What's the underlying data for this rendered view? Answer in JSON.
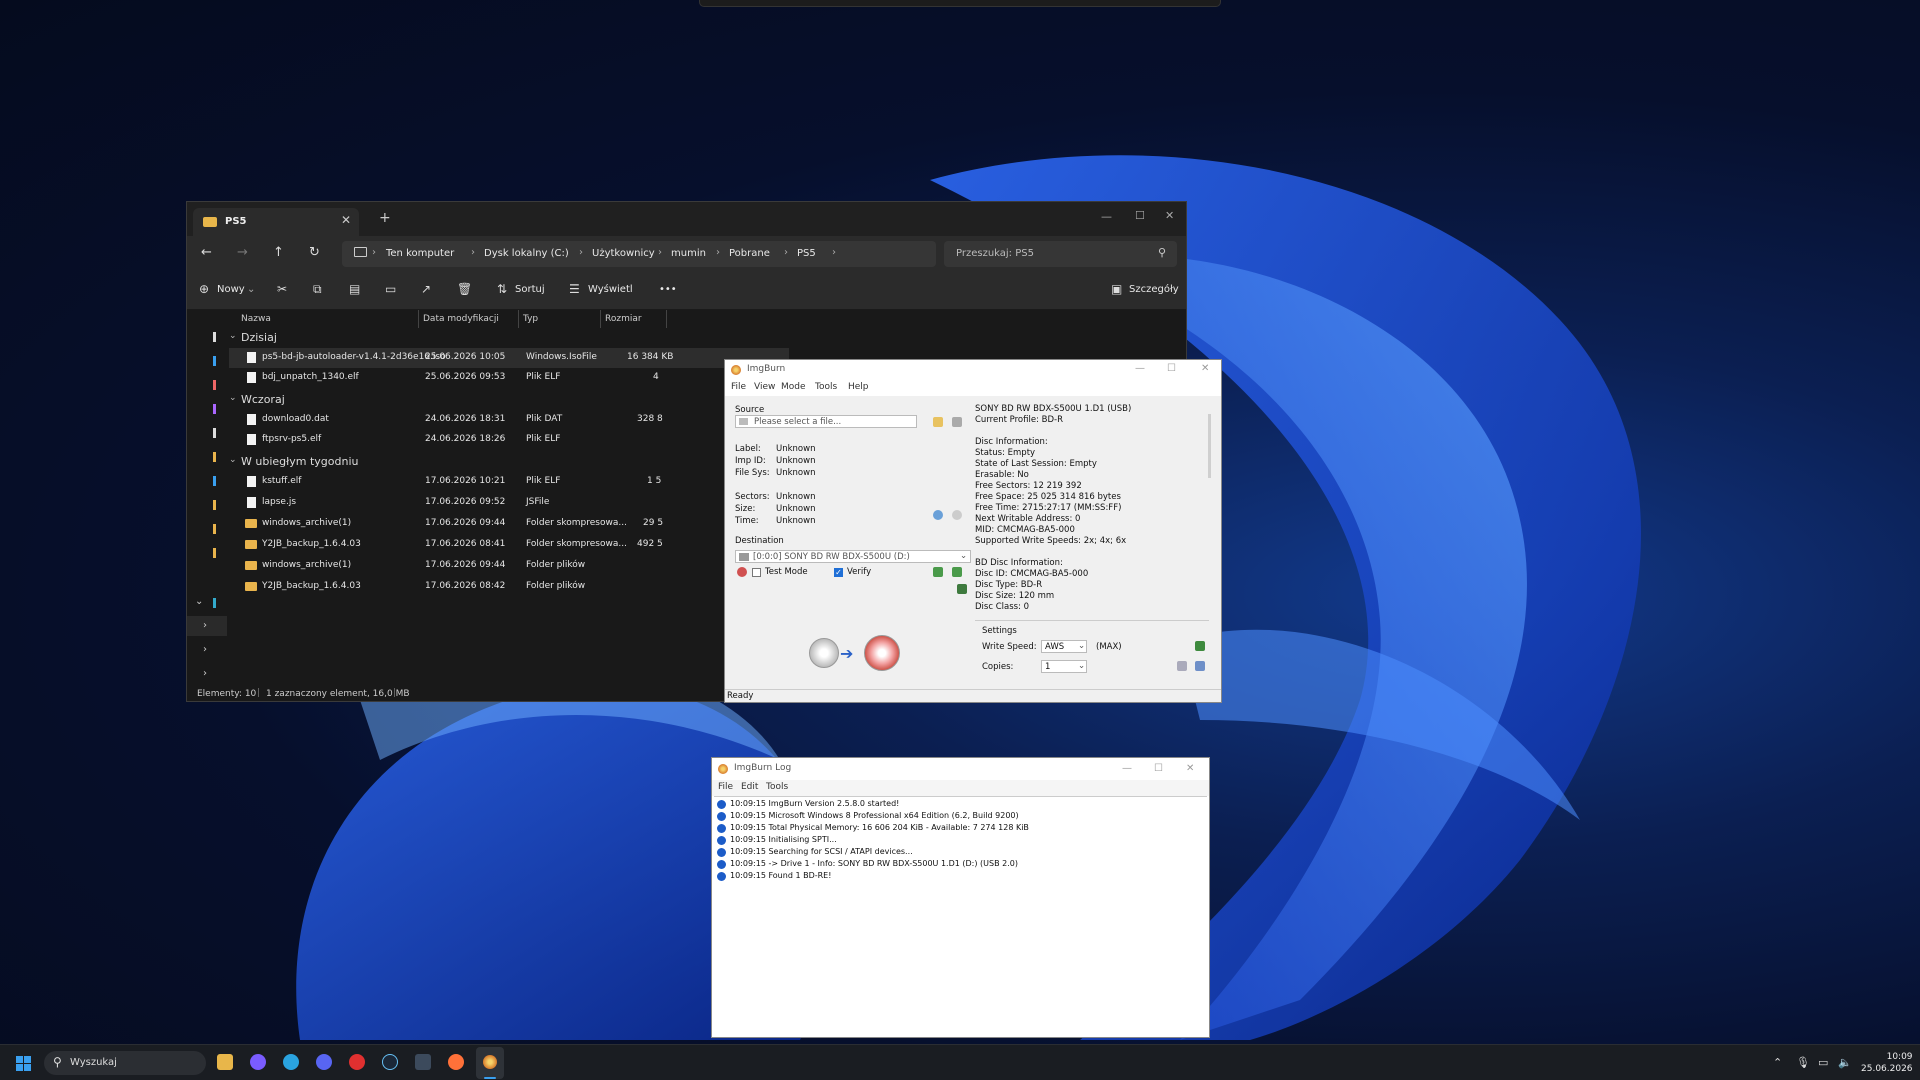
{
  "explorer": {
    "tab_title": "PS5",
    "close_tab": "✕",
    "new_tab": "+",
    "nav": {
      "back": "←",
      "forward": "→",
      "up": "↑",
      "refresh": "↻"
    },
    "breadcrumb": [
      "Ten komputer",
      "Dysk lokalny (C:)",
      "Użytkownicy",
      "mumin",
      "Pobrane",
      "PS5"
    ],
    "search_placeholder": "Przeszukaj: PS5",
    "toolbar": {
      "new": "Nowy",
      "sort": "Sortuj",
      "view": "Wyświetl",
      "more": "•••",
      "details": "Szczegóły"
    },
    "columns": {
      "name": "Nazwa",
      "date": "Data modyfikacji",
      "type": "Typ",
      "size": "Rozmiar"
    },
    "groups": [
      {
        "label": "Dzisiaj",
        "items": [
          {
            "name": "ps5-bd-jb-autoloader-v1.4.1-2d36e16.iso",
            "date": "25.06.2026 10:05",
            "type": "Windows.IsoFile",
            "size": "16 384 KB",
            "kind": "file",
            "selected": true
          },
          {
            "name": "bdj_unpatch_1340.elf",
            "date": "25.06.2026 09:53",
            "type": "Plik ELF",
            "size": "4",
            "kind": "file"
          }
        ]
      },
      {
        "label": "Wczoraj",
        "items": [
          {
            "name": "download0.dat",
            "date": "24.06.2026 18:31",
            "type": "Plik DAT",
            "size": "328 8",
            "kind": "file"
          },
          {
            "name": "ftpsrv-ps5.elf",
            "date": "24.06.2026 18:26",
            "type": "Plik ELF",
            "size": "",
            "kind": "file"
          }
        ]
      },
      {
        "label": "W ubiegłym tygodniu",
        "items": [
          {
            "name": "kstuff.elf",
            "date": "17.06.2026 10:21",
            "type": "Plik ELF",
            "size": "1 5",
            "kind": "file"
          },
          {
            "name": "lapse.js",
            "date": "17.06.2026 09:52",
            "type": "JSFile",
            "size": "",
            "kind": "file"
          },
          {
            "name": "windows_archive(1)",
            "date": "17.06.2026 09:44",
            "type": "Folder skompresowa...",
            "size": "29 5",
            "kind": "folder"
          },
          {
            "name": "Y2JB_backup_1.6.4.03",
            "date": "17.06.2026 08:41",
            "type": "Folder skompresowa...",
            "size": "492 5",
            "kind": "folder"
          },
          {
            "name": "windows_archive(1)",
            "date": "17.06.2026 09:44",
            "type": "Folder plików",
            "size": "",
            "kind": "folder"
          },
          {
            "name": "Y2JB_backup_1.6.4.03",
            "date": "17.06.2026 08:42",
            "type": "Folder plików",
            "size": "",
            "kind": "folder"
          }
        ]
      }
    ],
    "status_left": "Elementy: 10",
    "status_right": "1 zaznaczony element, 16,0 MB"
  },
  "imgburn": {
    "title": "ImgBurn",
    "menu": [
      "File",
      "View",
      "Mode",
      "Tools",
      "Help"
    ],
    "source_label": "Source",
    "source_placeholder": "Please select a file...",
    "fields": [
      {
        "k": "Label:",
        "v": "Unknown"
      },
      {
        "k": "Imp ID:",
        "v": "Unknown"
      },
      {
        "k": "File Sys:",
        "v": "Unknown"
      }
    ],
    "fields2": [
      {
        "k": "Sectors:",
        "v": "Unknown"
      },
      {
        "k": "Size:",
        "v": "Unknown"
      },
      {
        "k": "Time:",
        "v": "Unknown"
      }
    ],
    "destination_label": "Destination",
    "destination_value": "[0:0:0] SONY BD RW BDX-S500U (D:)",
    "test_mode": "Test Mode",
    "verify": "Verify",
    "info_lines": [
      "SONY BD RW BDX-S500U 1.D1 (USB)",
      "Current Profile: BD-R",
      "",
      "Disc Information:",
      "Status: Empty",
      "State of Last Session: Empty",
      "Erasable: No",
      "Free Sectors: 12 219 392",
      "Free Space: 25 025 314 816 bytes",
      "Free Time: 2715:27:17 (MM:SS:FF)",
      "Next Writable Address: 0",
      "MID: CMCMAG-BA5-000",
      "Supported Write Speeds: 2x; 4x; 6x",
      "",
      "BD Disc Information:",
      "Disc ID: CMCMAG-BA5-000",
      "Disc Type: BD-R",
      "Disc Size: 120 mm",
      "Disc Class: 0"
    ],
    "settings_label": "Settings",
    "write_speed_label": "Write Speed:",
    "write_speed_value": "AWS",
    "write_speed_max": "(MAX)",
    "copies_label": "Copies:",
    "copies_value": "1",
    "status": "Ready"
  },
  "log": {
    "title": "ImgBurn Log",
    "menu": [
      "File",
      "Edit",
      "Tools"
    ],
    "lines": [
      "10:09:15 ImgBurn Version 2.5.8.0 started!",
      "10:09:15 Microsoft Windows 8 Professional x64 Edition (6.2, Build 9200)",
      "10:09:15 Total Physical Memory: 16 606 204 KiB  -  Available: 7 274 128 KiB",
      "10:09:15 Initialising SPTI...",
      "10:09:15 Searching for SCSI / ATAPI devices...",
      "10:09:15 -> Drive 1 - Info: SONY BD RW BDX-S500U 1.D1 (D:) (USB 2.0)",
      "10:09:15 Found 1 BD-RE!"
    ]
  },
  "taskbar": {
    "search": "Wyszukaj",
    "time": "10:09",
    "date": "25.06.2026"
  },
  "colors": {
    "accent": "#3aa0f0",
    "folder": "#e8b64a",
    "explorer_bg": "#191919"
  }
}
